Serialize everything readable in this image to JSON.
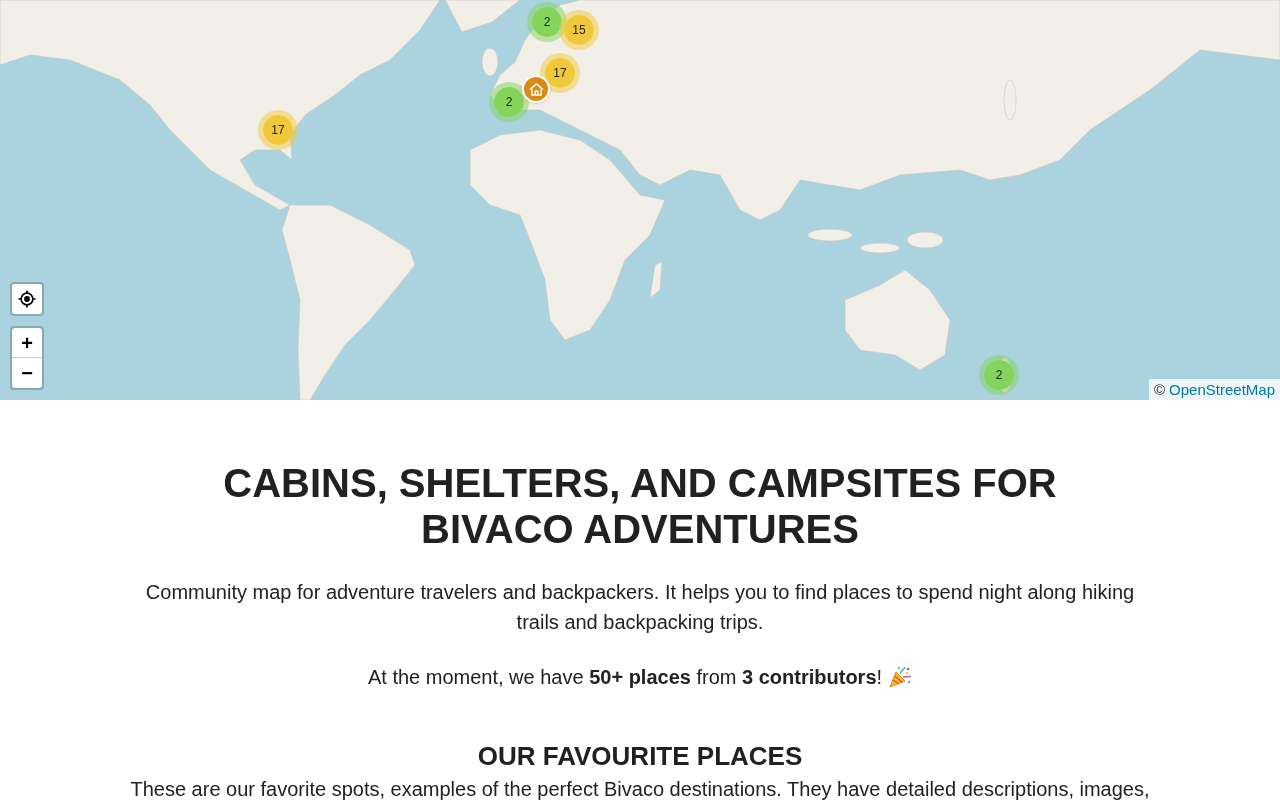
{
  "map": {
    "markers": [
      {
        "kind": "cluster",
        "count": "2",
        "color": "#84d35a"
      },
      {
        "kind": "cluster",
        "count": "15",
        "color": "#f0c93a"
      },
      {
        "kind": "cluster",
        "count": "17",
        "color": "#f0c93a"
      },
      {
        "kind": "place"
      },
      {
        "kind": "cluster",
        "count": "2",
        "color": "#84d35a"
      },
      {
        "kind": "cluster",
        "count": "17",
        "color": "#f0c93a"
      },
      {
        "kind": "cluster",
        "count": "2",
        "color": "#84d35a"
      }
    ],
    "zoom": {
      "zoom_in": "+",
      "zoom_out": "−"
    },
    "attribution": {
      "prefix": "©",
      "link": "OpenStreetMap"
    }
  },
  "hero": {
    "title": "CABINS, SHELTERS, AND CAMPSITES FOR BIVACO ADVENTURES",
    "description": "Community map for adventure travelers and backpackers. It helps you to find places to spend night along hiking trails and backpacking trips.",
    "stats": "At the moment, we have **50+ places** from **3 contributors**!"
  },
  "favourites": {
    "title": "OUR FAVOURITE PLACES",
    "description": "These are our favorite spots, examples of the perfect Bivaco destinations. They have detailed descriptions, images,"
  }
}
